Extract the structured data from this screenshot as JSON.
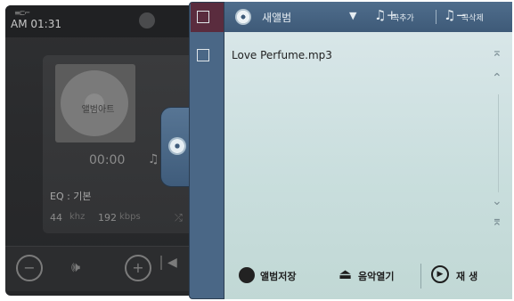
{
  "player": {
    "clock": "AM 01:31",
    "album_art_label": "앨범아트",
    "time": "00:00",
    "eq": "EQ : 기본",
    "khz_value": "44",
    "khz_unit": "khz",
    "kbps_value": "192",
    "kbps_unit": "kbps",
    "controls": {
      "vol_down": "−",
      "speaker": "🕪",
      "vol_up": "+",
      "prev": "◀"
    }
  },
  "playlist": {
    "album_title": "새앨범",
    "dropdown": "▼",
    "add_song_label": "곡추가",
    "delete_song_label": "곡삭제",
    "tracks": [
      {
        "name": "Love Perfume.mp3",
        "checked": false
      }
    ],
    "scroll": {
      "top": "⌅",
      "up": "⌃",
      "down": "⌄",
      "bottom": "⌆"
    },
    "bottom": {
      "save_album_label": "앨범저장",
      "open_music_label": "음악열기",
      "play_label": "재생"
    }
  },
  "colors": {
    "rail": "#4a6786",
    "header": "#4f6d8c",
    "list_bg": "#d8e6e8",
    "header_check_cell": "#5a2c3e"
  },
  "icons": [
    "status-icon",
    "note-icon",
    "shuffle-icon",
    "speaker-icon",
    "disc-icon",
    "album-icon",
    "add-song-icon",
    "delete-song-icon",
    "scroll-top-icon",
    "scroll-up-icon",
    "scroll-down-icon",
    "scroll-bottom-icon",
    "save-album-icon",
    "open-music-icon",
    "play-icon"
  ]
}
